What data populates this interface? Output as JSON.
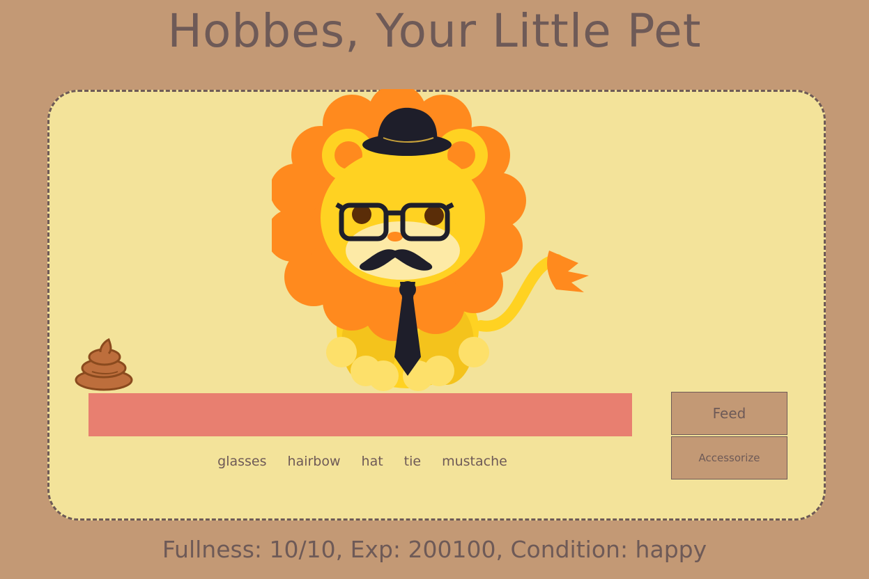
{
  "title": "Hobbes, Your Little Pet",
  "pet": {
    "accessories_worn": [
      "hat",
      "glasses",
      "mustache",
      "tie"
    ]
  },
  "accessories": [
    {
      "label": "glasses"
    },
    {
      "label": "hairbow"
    },
    {
      "label": "hat"
    },
    {
      "label": "tie"
    },
    {
      "label": "mustache"
    }
  ],
  "buttons": {
    "feed_label": "Feed",
    "accessorize_label": "Accessorize"
  },
  "status": {
    "text": "Fullness: 10/10, Exp: 200100, Condition: happy"
  },
  "colors": {
    "background": "#c39975",
    "panel": "#f3e39a",
    "text": "#6e5a57",
    "food_bar": "#e87f70",
    "mane": "#ff8a1e",
    "body": "#ffd222"
  }
}
